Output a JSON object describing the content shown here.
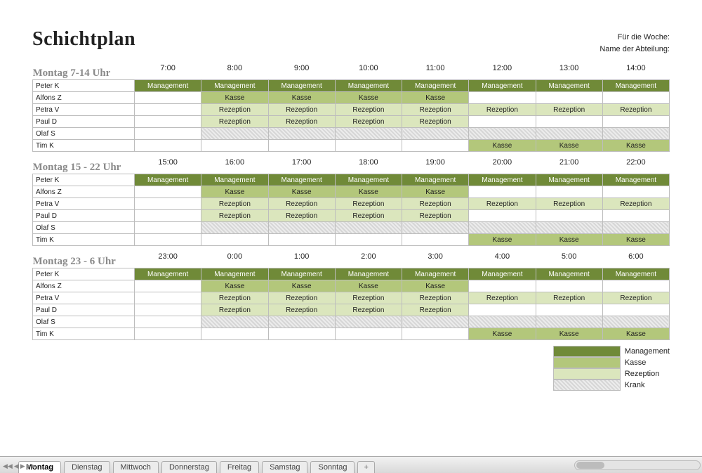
{
  "title": "Schichtplan",
  "header": {
    "week_label": "Für die Woche:",
    "dept_label": "Name der Abteilung:"
  },
  "employees": [
    "Peter K",
    "Alfons Z",
    "Petra V",
    "Paul D",
    "Olaf S",
    "Tim K"
  ],
  "sections": [
    {
      "title": "Montag 7-14 Uhr",
      "hours": [
        "7:00",
        "8:00",
        "9:00",
        "10:00",
        "11:00",
        "12:00",
        "13:00",
        "14:00"
      ],
      "rows": [
        [
          "Management",
          "Management",
          "Management",
          "Management",
          "Management",
          "Management",
          "Management",
          "Management"
        ],
        [
          "",
          "Kasse",
          "Kasse",
          "Kasse",
          "Kasse",
          "",
          "",
          ""
        ],
        [
          "",
          "Rezeption",
          "Rezeption",
          "Rezeption",
          "Rezeption",
          "Rezeption",
          "Rezeption",
          "Rezeption"
        ],
        [
          "",
          "Rezeption",
          "Rezeption",
          "Rezeption",
          "Rezeption",
          "",
          "",
          ""
        ],
        [
          "",
          "Krank",
          "Krank",
          "Krank",
          "Krank",
          "Krank",
          "Krank",
          "Krank"
        ],
        [
          "",
          "",
          "",
          "",
          "",
          "Kasse",
          "Kasse",
          "Kasse"
        ]
      ]
    },
    {
      "title": "Montag 15 - 22 Uhr",
      "hours": [
        "15:00",
        "16:00",
        "17:00",
        "18:00",
        "19:00",
        "20:00",
        "21:00",
        "22:00"
      ],
      "rows": [
        [
          "Management",
          "Management",
          "Management",
          "Management",
          "Management",
          "Management",
          "Management",
          "Management"
        ],
        [
          "",
          "Kasse",
          "Kasse",
          "Kasse",
          "Kasse",
          "",
          "",
          ""
        ],
        [
          "",
          "Rezeption",
          "Rezeption",
          "Rezeption",
          "Rezeption",
          "Rezeption",
          "Rezeption",
          "Rezeption"
        ],
        [
          "",
          "Rezeption",
          "Rezeption",
          "Rezeption",
          "Rezeption",
          "",
          "",
          ""
        ],
        [
          "",
          "Krank",
          "Krank",
          "Krank",
          "Krank",
          "Krank",
          "Krank",
          "Krank"
        ],
        [
          "",
          "",
          "",
          "",
          "",
          "Kasse",
          "Kasse",
          "Kasse"
        ]
      ]
    },
    {
      "title": "Montag 23 - 6 Uhr",
      "hours": [
        "23:00",
        "0:00",
        "1:00",
        "2:00",
        "3:00",
        "4:00",
        "5:00",
        "6:00"
      ],
      "rows": [
        [
          "Management",
          "Management",
          "Management",
          "Management",
          "Management",
          "Management",
          "Management",
          "Management"
        ],
        [
          "",
          "Kasse",
          "Kasse",
          "Kasse",
          "Kasse",
          "",
          "",
          ""
        ],
        [
          "",
          "Rezeption",
          "Rezeption",
          "Rezeption",
          "Rezeption",
          "Rezeption",
          "Rezeption",
          "Rezeption"
        ],
        [
          "",
          "Rezeption",
          "Rezeption",
          "Rezeption",
          "Rezeption",
          "",
          "",
          ""
        ],
        [
          "",
          "Krank",
          "Krank",
          "Krank",
          "Krank",
          "Krank",
          "Krank",
          "Krank"
        ],
        [
          "",
          "",
          "",
          "",
          "",
          "Kasse",
          "Kasse",
          "Kasse"
        ]
      ]
    }
  ],
  "legend": [
    {
      "key": "Management",
      "class": "c-mgmt"
    },
    {
      "key": "Kasse",
      "class": "c-kasse"
    },
    {
      "key": "Rezeption",
      "class": "c-rezep"
    },
    {
      "key": "Krank",
      "class": "c-krank"
    }
  ],
  "tabs": [
    "Montag",
    "Dienstag",
    "Mittwoch",
    "Donnerstag",
    "Freitag",
    "Samstag",
    "Sonntag"
  ],
  "active_tab": 0,
  "add_tab_label": "+"
}
